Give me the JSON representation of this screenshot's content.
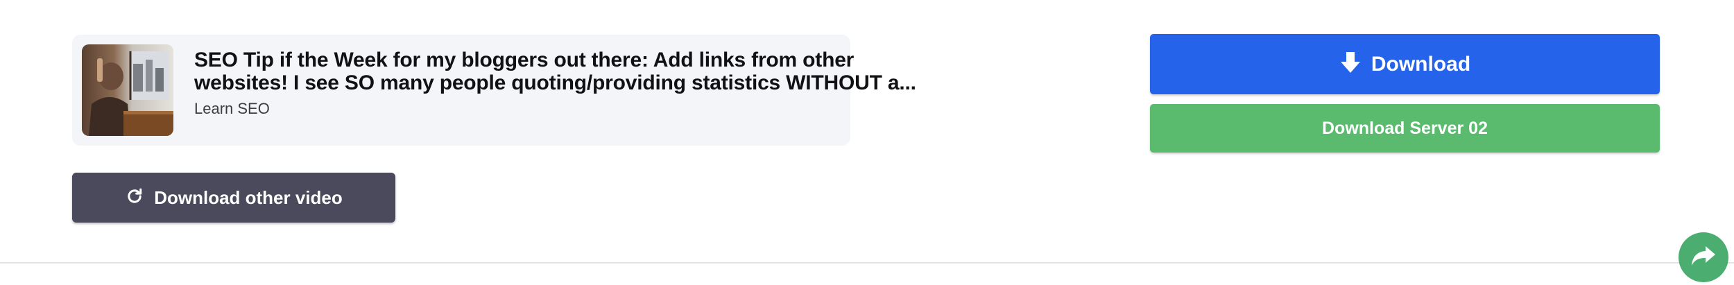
{
  "video": {
    "title": "SEO Tip if the Week for my bloggers out there: Add links from other\nwebsites! I see SO many people quoting/providing statistics WITHOUT a...",
    "channel": "Learn SEO",
    "thumbnail_icon": "video-thumbnail"
  },
  "actions": {
    "download_label": "Download",
    "download_icon": "arrow-down-icon",
    "download_server2_label": "Download Server 02",
    "download_other_label": "Download other video",
    "download_other_icon": "refresh-icon",
    "share_icon": "share-icon"
  },
  "colors": {
    "primary": "#2563eb",
    "secondary": "#5aba6e",
    "dark_button": "#4b4a5c",
    "card_bg": "#f4f5f9",
    "share": "#4bae70"
  }
}
